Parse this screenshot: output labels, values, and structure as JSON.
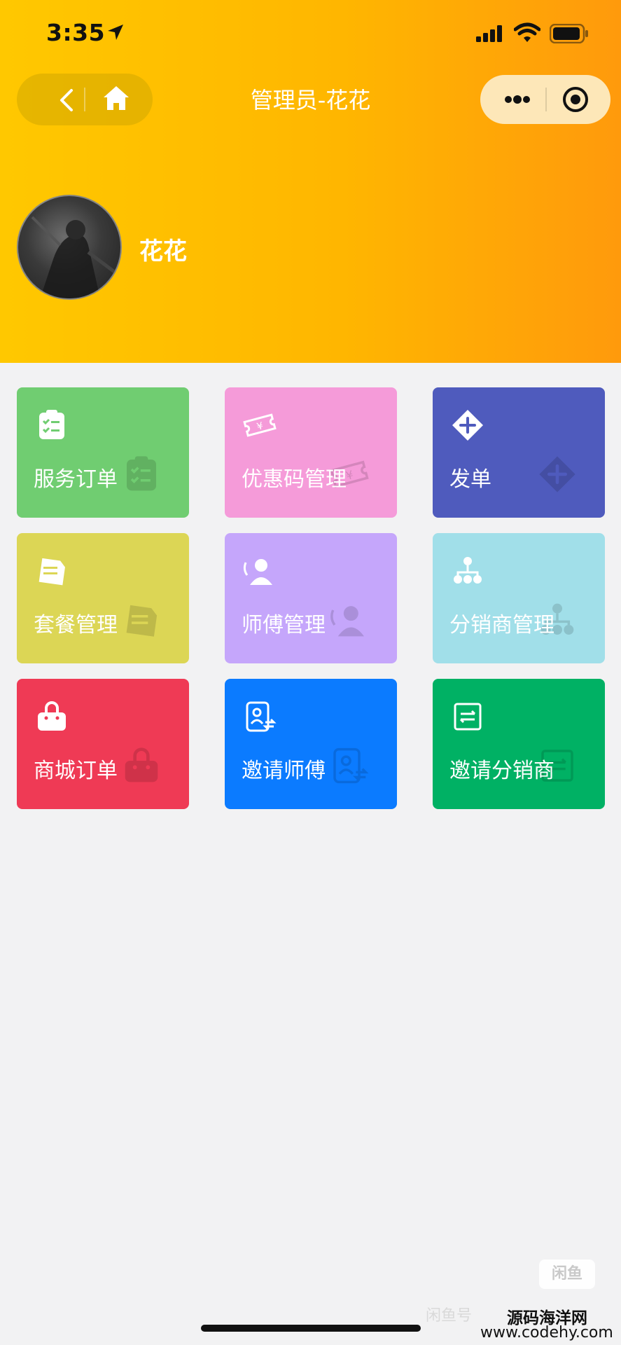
{
  "status_bar": {
    "time": "3:35"
  },
  "nav": {
    "title": "管理员-花花"
  },
  "profile": {
    "name": "花花"
  },
  "tiles": [
    {
      "label": "服务订单",
      "color": "#70cd71",
      "icon": "clipboard-check-icon"
    },
    {
      "label": "优惠码管理",
      "color": "#f59bd9",
      "icon": "coupon-ticket-icon"
    },
    {
      "label": "发单",
      "color": "#4f5bbd",
      "icon": "plus-circle-icon"
    },
    {
      "label": "套餐管理",
      "color": "#dcd655",
      "icon": "package-notes-icon"
    },
    {
      "label": "师傅管理",
      "color": "#c5a6fb",
      "icon": "worker-icon"
    },
    {
      "label": "分销商管理",
      "color": "#a1dfe9",
      "icon": "org-tree-icon"
    },
    {
      "label": "商城订单",
      "color": "#ef3a55",
      "icon": "shopping-bag-icon"
    },
    {
      "label": "邀请师傅",
      "color": "#0b7bff",
      "icon": "invite-badge-icon"
    },
    {
      "label": "邀请分销商",
      "color": "#00b164",
      "icon": "invite-frame-icon"
    }
  ],
  "watermark": {
    "badge": "闲鱼",
    "faint_text": "闲鱼号",
    "site_name": "源码海洋网",
    "site_url": "www.codehy.com"
  }
}
